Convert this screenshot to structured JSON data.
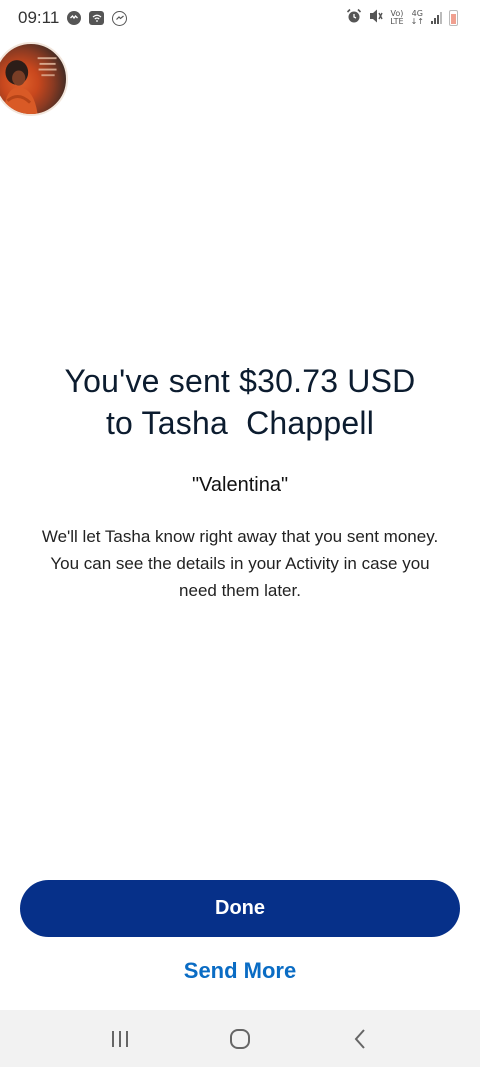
{
  "status_bar": {
    "time": "09:11",
    "notifications": [
      "chat-bubble-icon",
      "wifi-message-icon",
      "messenger-icon"
    ],
    "system_icons": [
      "alarm-icon",
      "mute-icon",
      "volte-icon",
      "4g-icon",
      "signal-icon",
      "battery-icon"
    ],
    "volte_label": "Vo)",
    "lte_label": "LTE",
    "network_label": "4G",
    "network_arrows": "↓↑"
  },
  "avatar": {
    "icon": "profile-avatar"
  },
  "confirmation": {
    "headline": "You've sent $30.73 USD\nto Tasha  Chappell",
    "note": "\"Valentina\"",
    "description": "We'll let Tasha know right away that you sent money. You can see the details in your Activity in case you need them later."
  },
  "actions": {
    "done_label": "Done",
    "send_more_label": "Send More"
  },
  "nav_bar": {
    "buttons": [
      "recent-apps-icon",
      "home-icon",
      "back-icon"
    ]
  },
  "colors": {
    "primary_button": "#063089",
    "link": "#0a6cc4",
    "headline": "#0c1c2f"
  }
}
